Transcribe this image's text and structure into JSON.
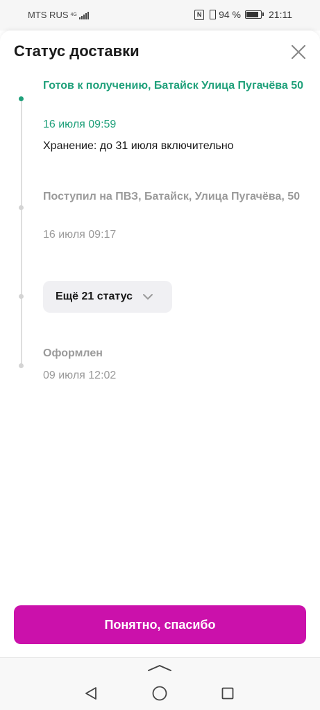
{
  "status_bar": {
    "carrier": "MTS RUS",
    "network": "4G",
    "battery_percent": "94 %",
    "battery_level": 0.94,
    "time": "21:11"
  },
  "sheet": {
    "title": "Статус доставки",
    "close_icon": "close-icon"
  },
  "timeline": {
    "items": [
      {
        "title": "Готов к получению, Батайск Улица Пугачёва 50",
        "date": "16 июля 09:59",
        "note": "Хранение: до 31 июля включительно",
        "active": true
      },
      {
        "title": "Поступил на ПВЗ, Батайск, Улица Пугачёва, 50",
        "date": "16 июля 09:17",
        "active": false
      },
      {
        "title": "Оформлен",
        "date": "09 июля 12:02",
        "active": false
      }
    ],
    "more_label": "Ещё 21 статус"
  },
  "primary_button": {
    "label": "Понятно, спасибо"
  },
  "colors": {
    "accent_green": "#1fa07a",
    "primary_magenta": "#cb11ab",
    "muted_gray": "#9a9a9a"
  },
  "nav_icons": [
    "back-icon",
    "home-icon",
    "recent-apps-icon"
  ]
}
